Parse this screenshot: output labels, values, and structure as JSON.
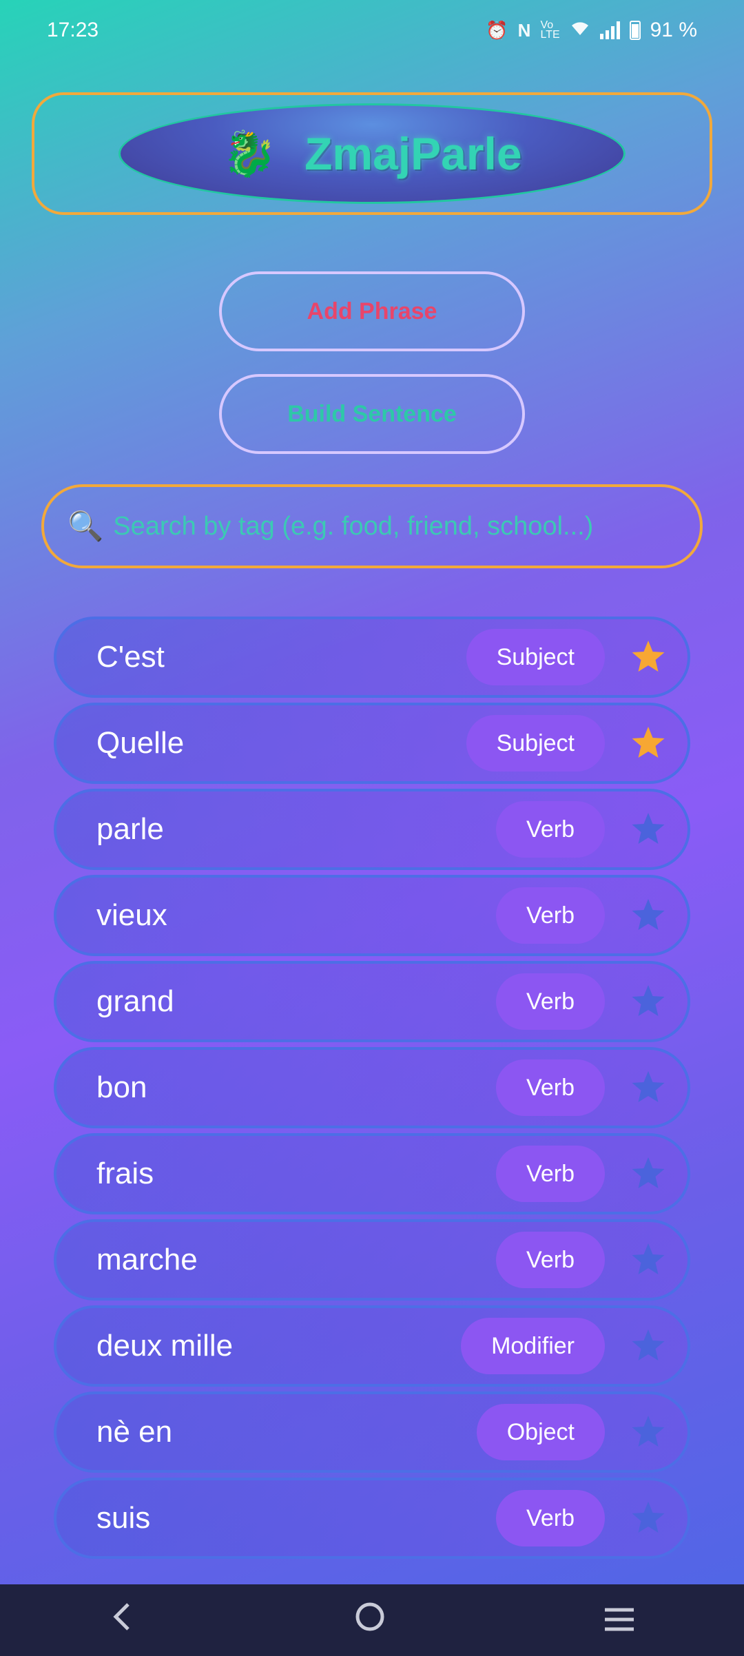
{
  "status": {
    "time": "17:23",
    "battery_text": "91 %",
    "icons": [
      "alarm-icon",
      "nfc-icon",
      "volte-icon",
      "wifi-icon",
      "signal-icon",
      "battery-icon"
    ]
  },
  "header": {
    "logo_icon": "dragon-icon",
    "title": "ZmajParle"
  },
  "actions": {
    "add_label": "Add Phrase",
    "build_label": "Build Sentence"
  },
  "search": {
    "placeholder": "Search by tag (e.g. food, friend, school...)",
    "value": ""
  },
  "phrases": [
    {
      "text": "C'est",
      "tag": "Subject",
      "favorite": true
    },
    {
      "text": "Quelle",
      "tag": "Subject",
      "favorite": true
    },
    {
      "text": "parle",
      "tag": "Verb",
      "favorite": false
    },
    {
      "text": "vieux",
      "tag": "Verb",
      "favorite": false
    },
    {
      "text": "grand",
      "tag": "Verb",
      "favorite": false
    },
    {
      "text": "bon",
      "tag": "Verb",
      "favorite": false
    },
    {
      "text": "frais",
      "tag": "Verb",
      "favorite": false
    },
    {
      "text": "marche",
      "tag": "Verb",
      "favorite": false
    },
    {
      "text": "deux mille",
      "tag": "Modifier",
      "favorite": false
    },
    {
      "text": "nè en",
      "tag": "Object",
      "favorite": false
    },
    {
      "text": "suis",
      "tag": "Verb",
      "favorite": false
    }
  ],
  "colors": {
    "accent_orange": "#f2a93b",
    "tag_purple": "#8c56f2",
    "star_active": "#f7a733",
    "star_inactive": "#4b63dc",
    "add_red": "#e8456a",
    "build_teal": "#2ec8a8"
  },
  "navbar": {
    "icons": [
      "back-icon",
      "home-icon",
      "recents-icon"
    ]
  }
}
